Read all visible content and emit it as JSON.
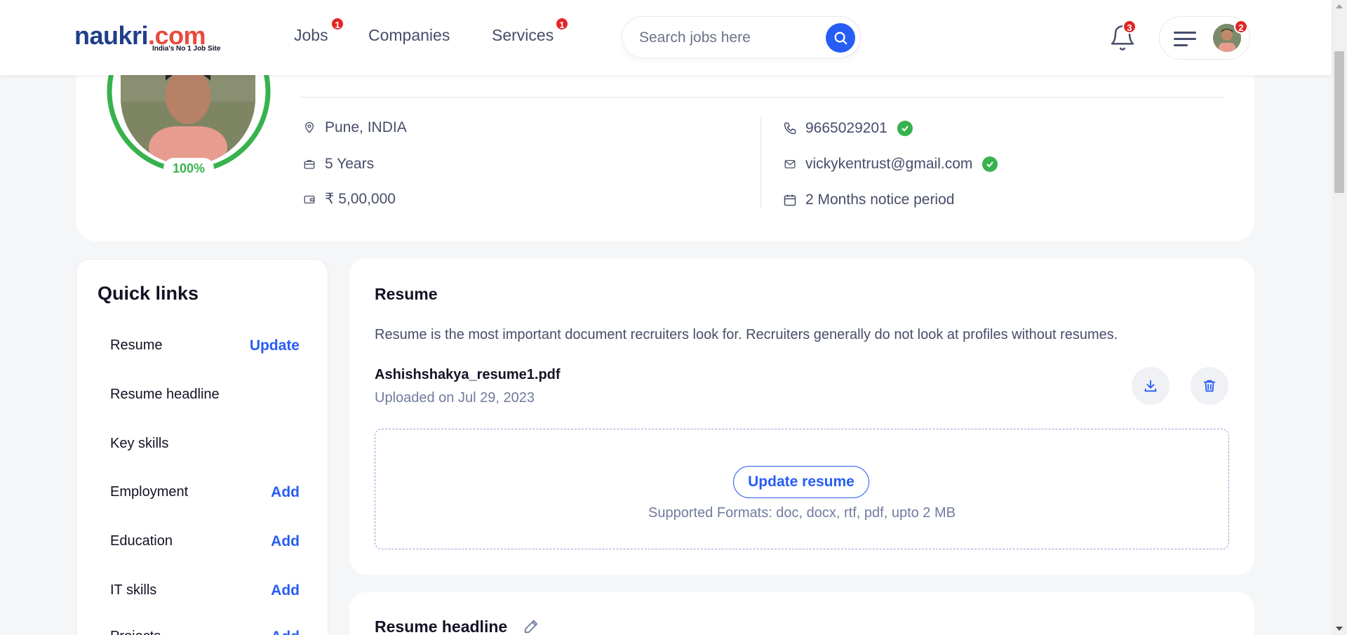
{
  "header": {
    "logo_text": "naukri",
    "logo_domain": ".com",
    "logo_tagline": "India's No 1 Job Site",
    "nav": [
      {
        "label": "Jobs",
        "badge": "1"
      },
      {
        "label": "Companies"
      },
      {
        "label": "Services",
        "badge": "1"
      }
    ],
    "search_placeholder": "Search jobs here",
    "notifications_badge": "3",
    "menu_badge": "2"
  },
  "profile": {
    "completion": "100%",
    "completion_value": 100,
    "location": "Pune, INDIA",
    "experience": "5 Years",
    "salary": "₹ 5,00,000",
    "phone": "9665029201",
    "email": "vickykentrust@gmail.com",
    "notice_period": "2 Months notice period"
  },
  "quick_links": {
    "title": "Quick links",
    "items": [
      {
        "label": "Resume",
        "action": "Update"
      },
      {
        "label": "Resume headline",
        "action": ""
      },
      {
        "label": "Key skills",
        "action": ""
      },
      {
        "label": "Employment",
        "action": "Add"
      },
      {
        "label": "Education",
        "action": "Add"
      },
      {
        "label": "IT skills",
        "action": "Add"
      },
      {
        "label": "Projects",
        "action": "Add"
      }
    ]
  },
  "resume": {
    "title": "Resume",
    "description": "Resume is the most important document recruiters look for. Recruiters generally do not look at profiles without resumes.",
    "file_name": "Ashishshakya_resume1.pdf",
    "uploaded": "Uploaded on Jul 29, 2023",
    "update_button": "Update resume",
    "formats": "Supported Formats: doc, docx, rtf, pdf, upto 2 MB"
  },
  "headline": {
    "title": "Resume headline"
  },
  "colors": {
    "brand_blue": "#275df5",
    "success_green": "#37b24d",
    "badge_red": "#e32525"
  }
}
